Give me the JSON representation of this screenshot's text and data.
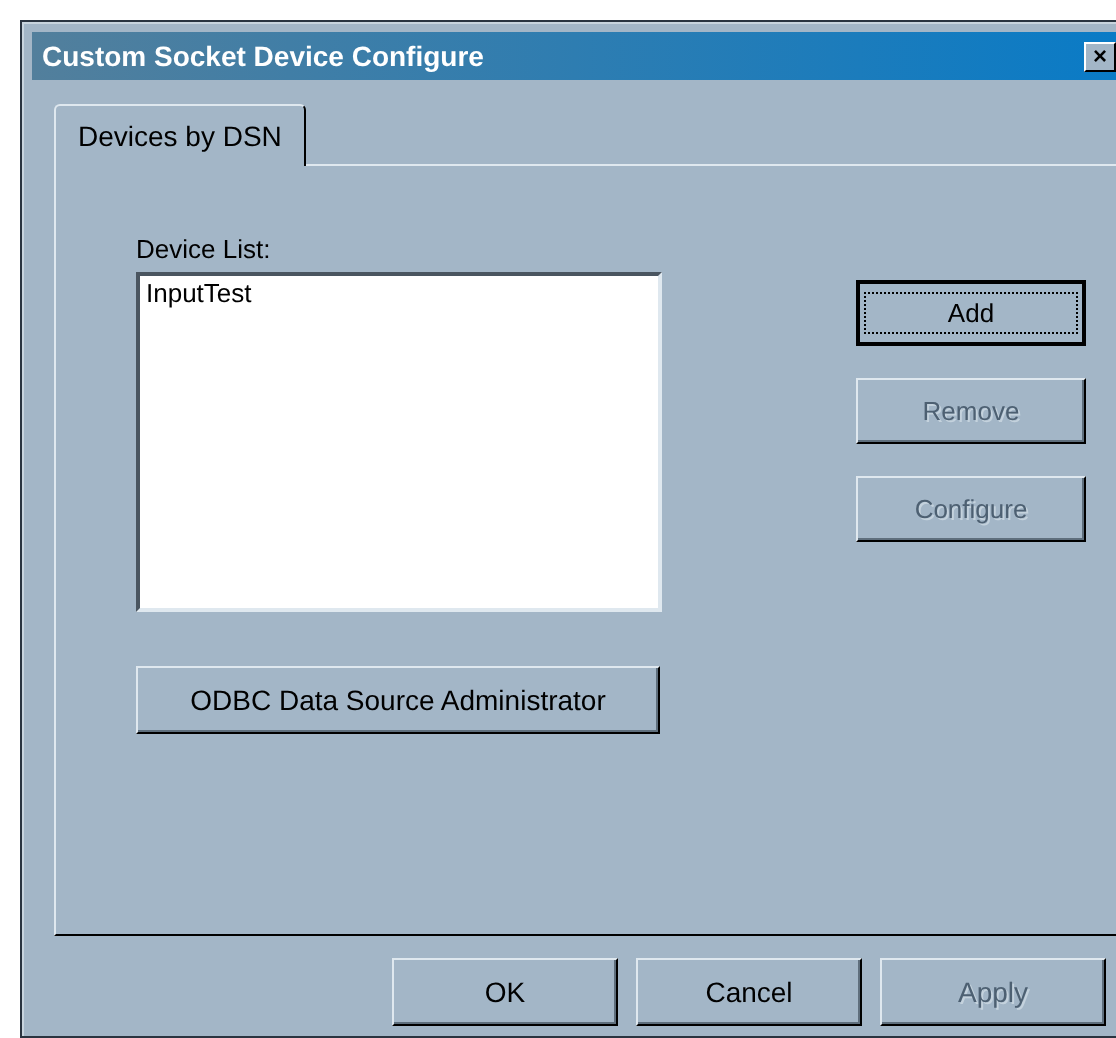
{
  "window": {
    "title": "Custom Socket Device Configure",
    "close": "×"
  },
  "tabs": [
    {
      "label": "Devices by DSN",
      "selected": true
    }
  ],
  "device_list": {
    "label": "Device List:",
    "items": [
      {
        "label": "InputTest",
        "selected": false
      }
    ]
  },
  "side_buttons": [
    {
      "label": "Add",
      "disabled": false,
      "focused": true
    },
    {
      "label": "Remove",
      "disabled": true,
      "focused": false
    },
    {
      "label": "Configure",
      "disabled": true,
      "focused": false
    }
  ],
  "odbc_button": {
    "label": "ODBC Data Source Administrator",
    "disabled": false
  },
  "buttons": [
    {
      "label": "OK",
      "disabled": false
    },
    {
      "label": "Cancel",
      "disabled": false
    },
    {
      "label": "Apply",
      "disabled": true
    }
  ]
}
